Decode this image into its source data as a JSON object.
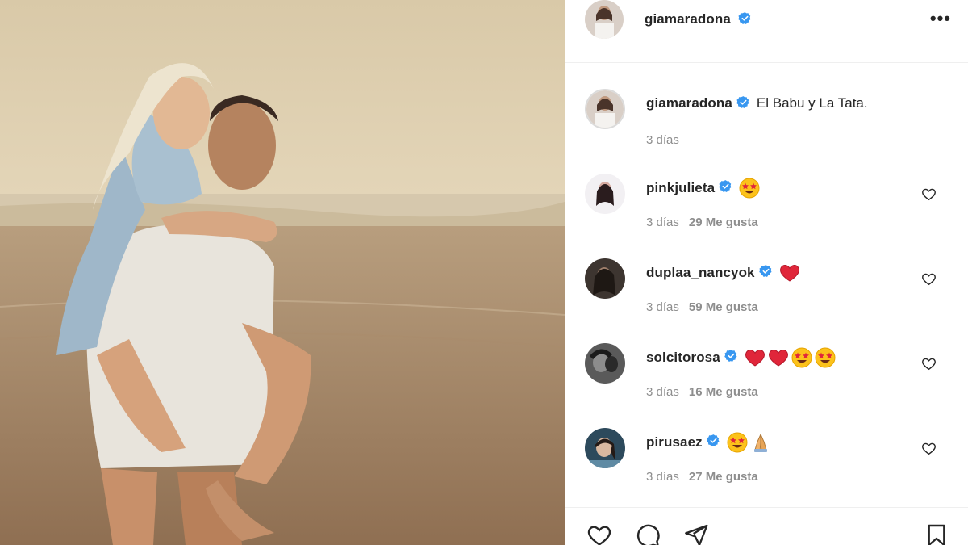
{
  "post": {
    "username": "giamaradona",
    "caption": "El Babu y La Tata.",
    "caption_time": "3 días",
    "more_label": "•••"
  },
  "comments": [
    {
      "username": "pinkjulieta",
      "emojis": [
        "star-struck"
      ],
      "time": "3 días",
      "likes": "29 Me gusta"
    },
    {
      "username": "duplaa_nancyok",
      "emojis": [
        "red-heart"
      ],
      "time": "3 días",
      "likes": "59 Me gusta"
    },
    {
      "username": "solcitorosa",
      "emojis": [
        "red-heart",
        "red-heart",
        "star-struck",
        "star-struck"
      ],
      "time": "3 días",
      "likes": "16 Me gusta"
    },
    {
      "username": "pirusaez",
      "emojis": [
        "star-struck",
        "folded-hands"
      ],
      "time": "3 días",
      "likes": "27 Me gusta"
    }
  ],
  "icons": {
    "verified": "verified-badge-icon",
    "like": "heart-icon",
    "comment": "comment-icon",
    "share": "paper-plane-icon",
    "save": "bookmark-icon",
    "more": "more-options-icon"
  },
  "colors": {
    "verified_blue": "#3897f0",
    "text": "#262626",
    "muted": "#8e8e8e",
    "heart_red": "#e0263a"
  }
}
